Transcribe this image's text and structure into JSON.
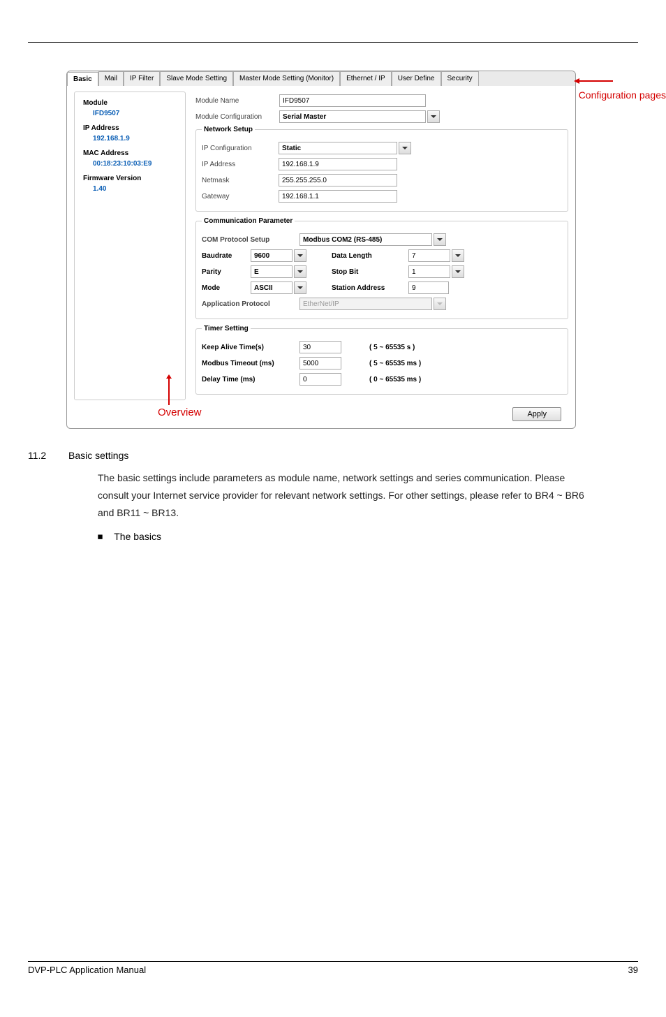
{
  "tabs": [
    "Basic",
    "Mail",
    "IP Filter",
    "Slave Mode Setting",
    "Master Mode Setting (Monitor)",
    "Ethernet / IP",
    "User Define",
    "Security"
  ],
  "overview": {
    "module_label": "Module",
    "module_value": "IFD9507",
    "ip_label": "IP Address",
    "ip_value": "192.168.1.9",
    "mac_label": "MAC Address",
    "mac_value": "00:18:23:10:03:E9",
    "fw_label": "Firmware Version",
    "fw_value": "1.40"
  },
  "module": {
    "name_label": "Module Name",
    "name_value": "IFD9507",
    "config_label": "Module Configuration",
    "config_value": "Serial Master"
  },
  "network": {
    "legend": "Network Setup",
    "ipconfig_label": "IP Configuration",
    "ipconfig_value": "Static",
    "ip_label": "IP Address",
    "ip_value": "192.168.1.9",
    "mask_label": "Netmask",
    "mask_value": "255.255.255.0",
    "gw_label": "Gateway",
    "gw_value": "192.168.1.1"
  },
  "comm": {
    "legend": "Communication Parameter",
    "proto_label": "COM Protocol Setup",
    "proto_value": "Modbus COM2 (RS-485)",
    "baud_label": "Baudrate",
    "baud_value": "9600",
    "datalen_label": "Data Length",
    "datalen_value": "7",
    "parity_label": "Parity",
    "parity_value": "E",
    "stop_label": "Stop Bit",
    "stop_value": "1",
    "mode_label": "Mode",
    "mode_value": "ASCII",
    "station_label": "Station Address",
    "station_value": "9",
    "appproto_label": "Application Protocol",
    "appproto_value": "EtherNet/IP"
  },
  "timer": {
    "legend": "Timer Setting",
    "keepalive_label": "Keep Alive Time(s)",
    "keepalive_value": "30",
    "keepalive_range": "( 5 ~ 65535 s )",
    "timeout_label": "Modbus Timeout (ms)",
    "timeout_value": "5000",
    "timeout_range": "( 5 ~ 65535 ms )",
    "delay_label": "Delay Time (ms)",
    "delay_value": "0",
    "delay_range": "( 0 ~ 65535 ms )"
  },
  "apply_label": "Apply",
  "annot": {
    "config": "Configuration pages",
    "overview": "Overview"
  },
  "section": {
    "num": "11.2",
    "title": "Basic settings",
    "text": "The basic settings include parameters as module name, network settings and series communication. Please consult your Internet service provider for relevant network settings. For other settings, please refer to BR4 ~ BR6 and BR11 ~ BR13.",
    "bullet": "The basics"
  },
  "footer": {
    "left": "DVP-PLC Application Manual",
    "right": "39"
  }
}
